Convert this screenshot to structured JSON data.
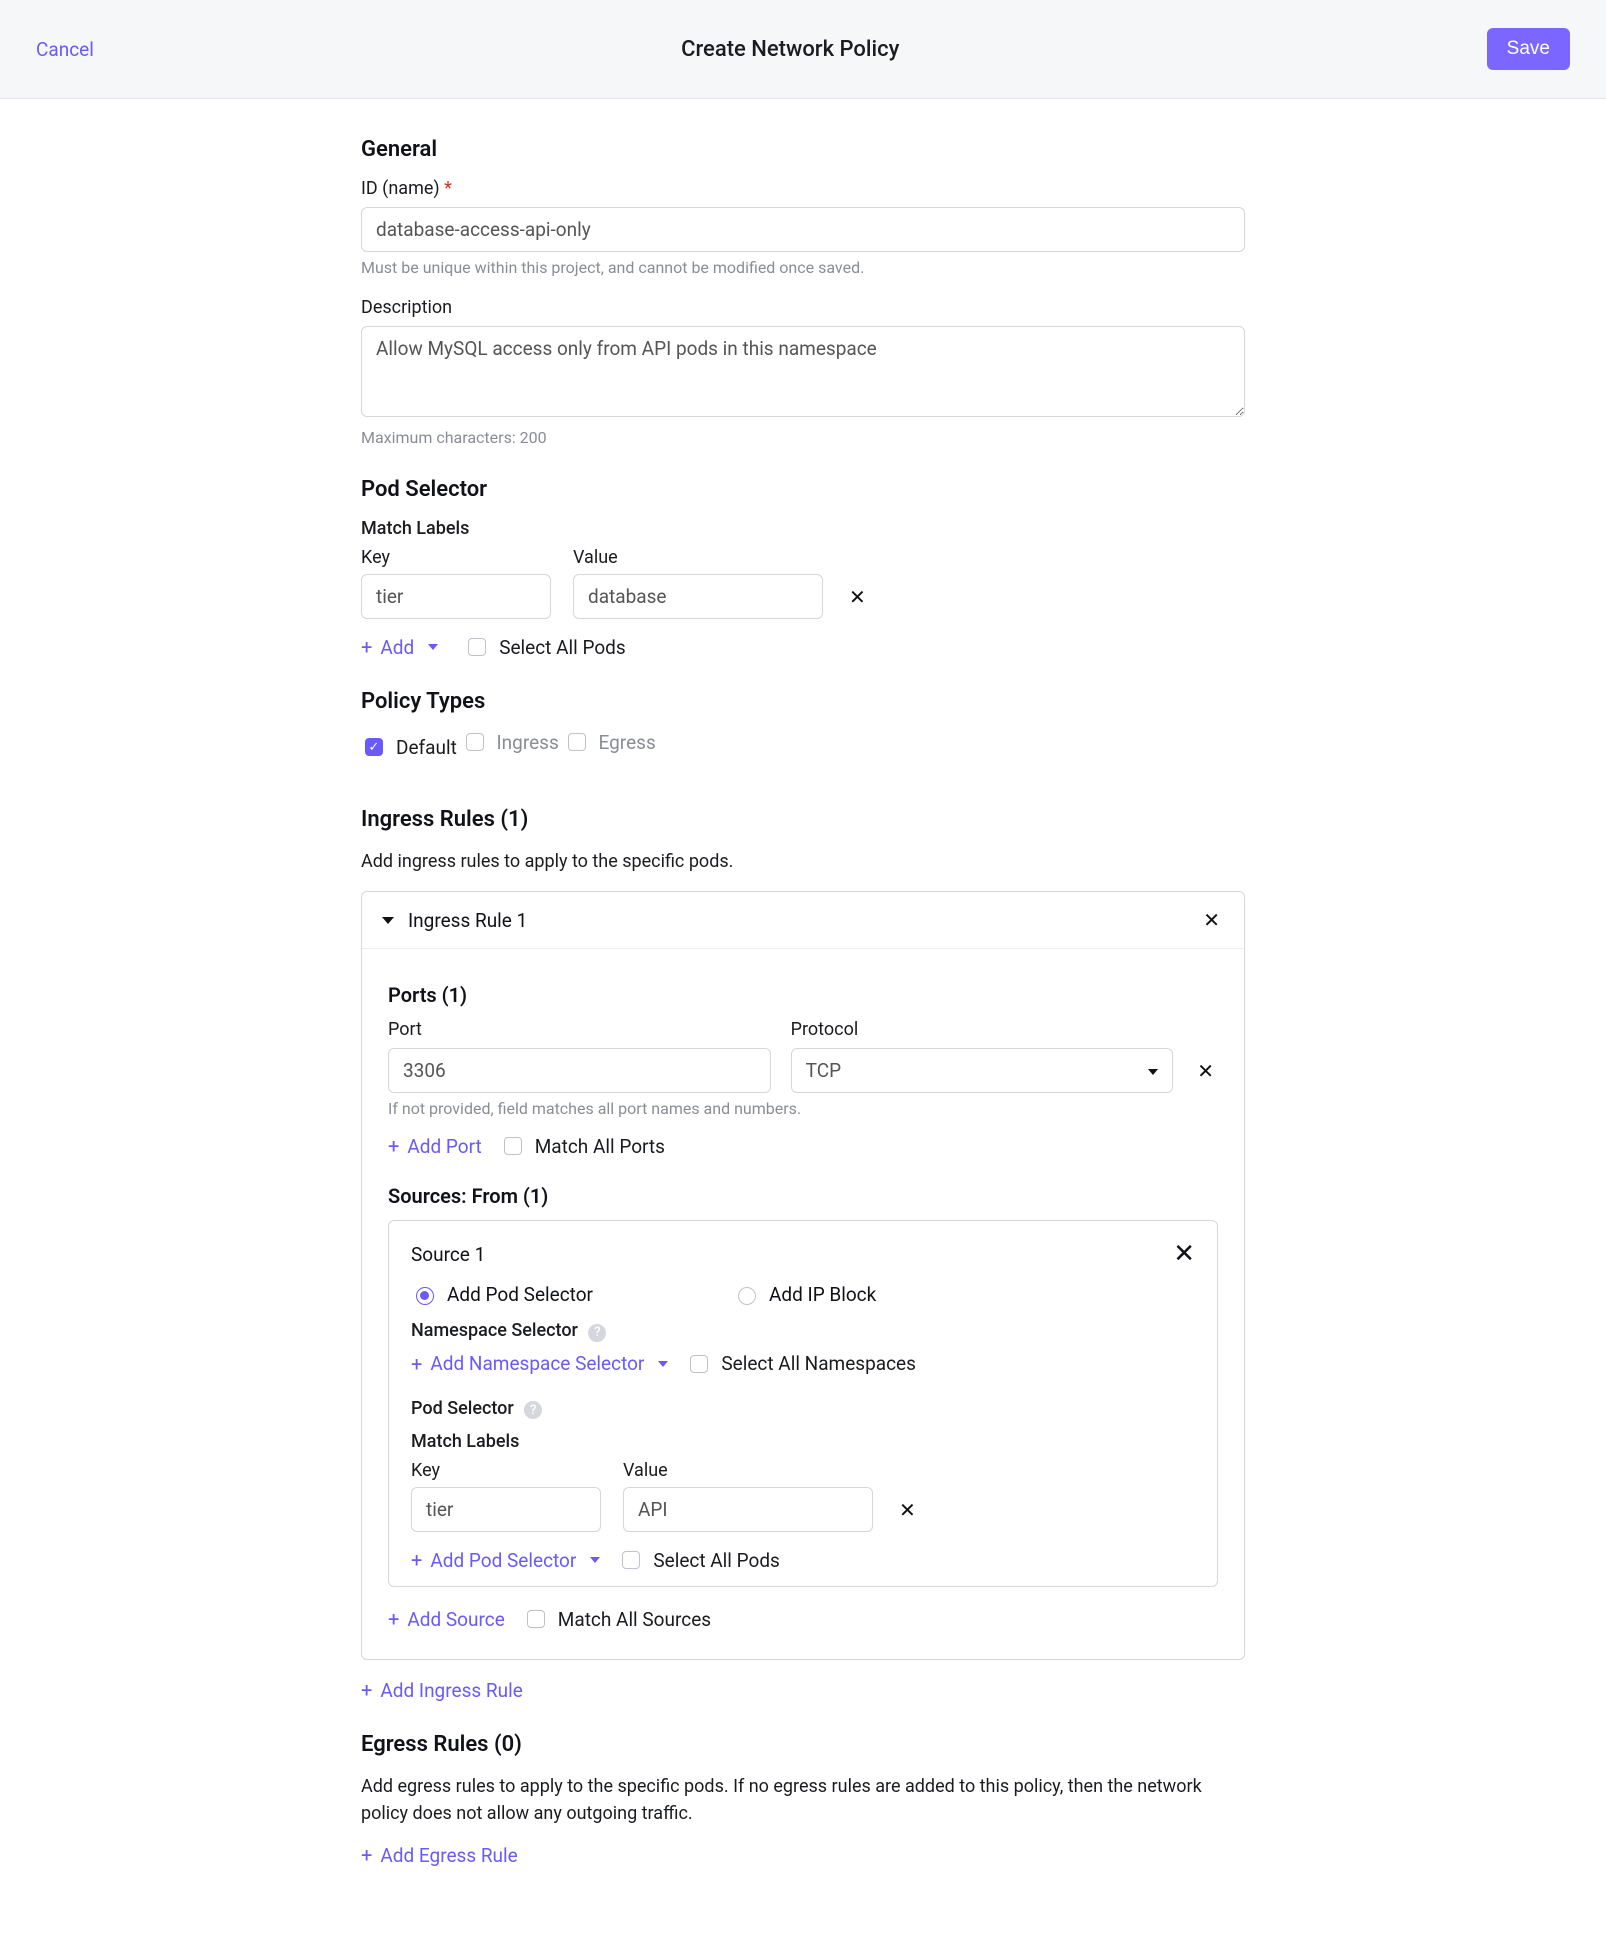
{
  "header": {
    "cancel": "Cancel",
    "title": "Create Network Policy",
    "save": "Save"
  },
  "general": {
    "heading": "General",
    "idLabel": "ID (name)",
    "idValue": "database-access-api-only",
    "idHint": "Must be unique within this project, and cannot be modified once saved.",
    "descLabel": "Description",
    "descValue": "Allow MySQL access only from API pods in this namespace",
    "descHint": "Maximum characters: 200"
  },
  "podSelector": {
    "heading": "Pod Selector",
    "matchLabels": "Match Labels",
    "keyLabel": "Key",
    "valueLabel": "Value",
    "key": "tier",
    "value": "database",
    "add": "Add",
    "selectAll": "Select All Pods"
  },
  "policyTypes": {
    "heading": "Policy Types",
    "default": "Default",
    "ingress": "Ingress",
    "egress": "Egress"
  },
  "ingress": {
    "heading": "Ingress Rules (1)",
    "desc": "Add ingress rules to apply to the specific pods.",
    "ruleTitle": "Ingress Rule 1",
    "portsHeading": "Ports (1)",
    "portLabel": "Port",
    "protocolLabel": "Protocol",
    "portValue": "3306",
    "protocolValue": "TCP",
    "portHint": "If not provided, field matches all port names and numbers.",
    "addPort": "Add Port",
    "matchAllPorts": "Match All Ports",
    "sourcesHeading": "Sources: From (1)",
    "sourceTitle": "Source 1",
    "radioPod": "Add Pod Selector",
    "radioIp": "Add IP Block",
    "nsSelector": "Namespace Selector",
    "addNs": "Add Namespace Selector",
    "selectAllNs": "Select All Namespaces",
    "podSelector": "Pod Selector",
    "matchLabels2": "Match Labels",
    "srcKey": "tier",
    "srcVal": "API",
    "addPodSel": "Add Pod Selector",
    "selectAllPods2": "Select All Pods",
    "addSource": "Add Source",
    "matchAllSources": "Match All Sources",
    "addIngressRule": "Add Ingress Rule"
  },
  "egress": {
    "heading": "Egress Rules (0)",
    "desc": "Add egress rules to apply to the specific pods. If no egress rules are added to this policy, then the network policy does not allow any outgoing traffic.",
    "addEgressRule": "Add Egress Rule"
  }
}
